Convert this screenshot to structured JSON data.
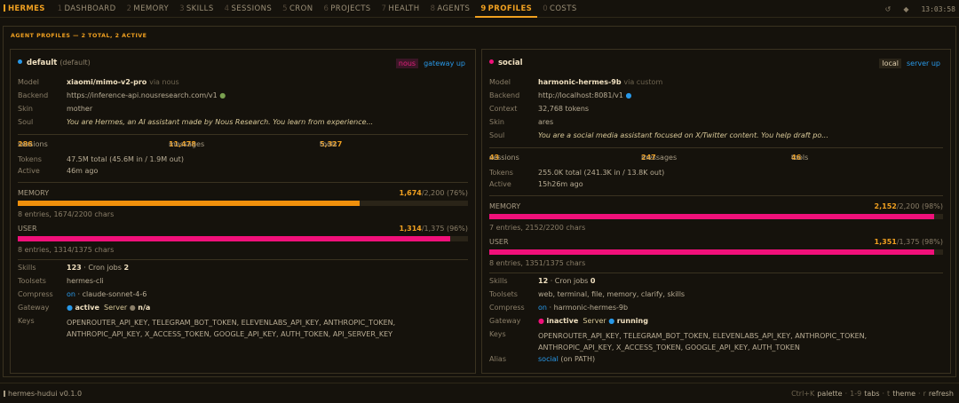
{
  "brand": "HERMES",
  "tabs": [
    {
      "n": "1",
      "label": "DASHBOARD"
    },
    {
      "n": "2",
      "label": "MEMORY"
    },
    {
      "n": "3",
      "label": "SKILLS"
    },
    {
      "n": "4",
      "label": "SESSIONS"
    },
    {
      "n": "5",
      "label": "CRON"
    },
    {
      "n": "6",
      "label": "PROJECTS"
    },
    {
      "n": "7",
      "label": "HEALTH"
    },
    {
      "n": "8",
      "label": "AGENTS"
    },
    {
      "n": "9",
      "label": "PROFILES"
    },
    {
      "n": "0",
      "label": "COSTS"
    }
  ],
  "top_icons": [
    "refresh-icon",
    "theme-icon"
  ],
  "refresh_glyph": "↺",
  "theme_glyph": "◆",
  "clock": "13:03:58",
  "section_title": "AGENT PROFILES — 2 TOTAL, 2 ACTIVE",
  "profiles": [
    {
      "name": "default",
      "default_tag": "(default)",
      "dot_color": "#2898e8",
      "provider_badge": "nous",
      "status_badge": "gateway up",
      "model": "xiaomi/mimo-v2-pro",
      "model_via": "via nous",
      "backend": "https://inference-api.nousresearch.com/v1",
      "skin": "mother",
      "soul": "You are Hermes, an AI assistant made by Nous Research. You learn from experience...",
      "sessions": "286",
      "sessions_label": "sessions",
      "messages": "11,478",
      "messages_label": "messages",
      "tools": "5,327",
      "tools_label": "tools",
      "tokens": "47.5M total (45.6M in / 1.9M out)",
      "active": "46m ago",
      "memory": {
        "label": "MEMORY",
        "used": "1,674",
        "total": "/2,200 (76%)",
        "fraction": 0.76,
        "color": "#f0900c",
        "foot": "8 entries, 1674/2200 chars"
      },
      "user": {
        "label": "USER",
        "used": "1,314",
        "total": "/1,375 (96%)",
        "fraction": 0.96,
        "color": "#f0107a",
        "foot": "8 entries, 1314/1375 chars"
      },
      "skills": "123",
      "cron_label": "· Cron jobs",
      "cron": "2",
      "toolsets": "hermes-cli",
      "compress_on": "on",
      "compress": "· claude-sonnet-4-6",
      "gw_state": "active",
      "gw_server": "Server",
      "gw_server_state": "n/a",
      "keys": "OPENROUTER_API_KEY, TELEGRAM_BOT_TOKEN, ELEVENLABS_API_KEY, ANTHROPIC_TOKEN, ANTHROPIC_API_KEY, X_ACCESS_TOKEN, GOOGLE_API_KEY, AUTH_TOKEN, API_SERVER_KEY"
    },
    {
      "name": "social",
      "dot_color": "#f0107a",
      "provider_badge": "local",
      "status_badge": "server up",
      "model": "harmonic-hermes-9b",
      "model_via": "via custom",
      "backend": "http://localhost:8081/v1",
      "context": "32,768 tokens",
      "skin": "ares",
      "soul": "You are a social media assistant focused on X/Twitter content. You help draft po...",
      "sessions": "43",
      "sessions_label": "sessions",
      "messages": "247",
      "messages_label": "messages",
      "tools": "46",
      "tools_label": "tools",
      "tokens": "255.0K total (241.3K in / 13.8K out)",
      "active": "15h26m ago",
      "memory": {
        "label": "MEMORY",
        "used": "2,152",
        "total": "/2,200 (98%)",
        "fraction": 0.98,
        "color": "#f0107a",
        "foot": "7 entries, 2152/2200 chars"
      },
      "user": {
        "label": "USER",
        "used": "1,351",
        "total": "/1,375 (98%)",
        "fraction": 0.98,
        "color": "#f0107a",
        "foot": "8 entries, 1351/1375 chars"
      },
      "skills": "12",
      "cron_label": "· Cron jobs",
      "cron": "0",
      "toolsets": "web, terminal, file, memory, clarify, skills",
      "compress_on": "on",
      "compress": "· harmonic-hermes-9b",
      "gw_state": "inactive",
      "gw_server": "Server",
      "gw_server_state": "running",
      "keys": "OPENROUTER_API_KEY, TELEGRAM_BOT_TOKEN, ELEVENLABS_API_KEY, ANTHROPIC_TOKEN, ANTHROPIC_API_KEY, X_ACCESS_TOKEN, GOOGLE_API_KEY, AUTH_TOKEN",
      "alias": "social",
      "alias_note": "(on PATH)"
    }
  ],
  "labels": {
    "model": "Model",
    "backend": "Backend",
    "context": "Context",
    "skin": "Skin",
    "soul": "Soul",
    "tokens": "Tokens",
    "active": "Active",
    "skills": "Skills",
    "toolsets": "Toolsets",
    "compress": "Compress",
    "gateway": "Gateway",
    "keys": "Keys",
    "alias": "Alias"
  },
  "footer": {
    "version": "hermes-hudui v0.1.0",
    "k1": "Ctrl+K",
    "t1": "palette",
    "sep1": "·",
    "k2": "1-9",
    "t2": "tabs",
    "sep2": "·",
    "k3": "t",
    "t3": "theme",
    "sep3": "·",
    "k4": "r",
    "t4": "refresh"
  },
  "colors": {
    "accent": "#f0a020",
    "blue": "#2898e8",
    "pink": "#f0107a",
    "orange": "#f0900c"
  }
}
